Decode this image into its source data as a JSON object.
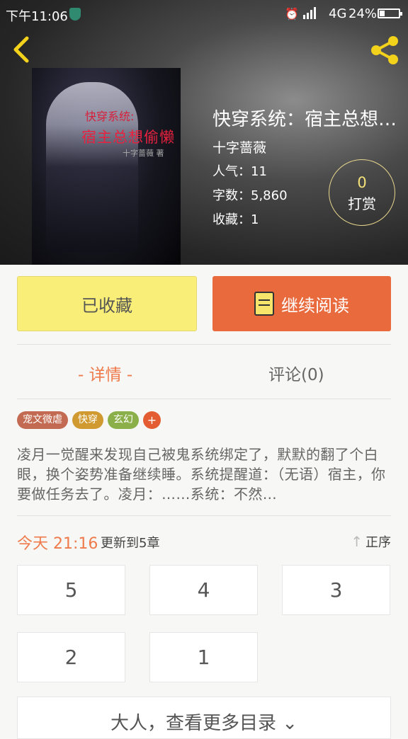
{
  "status_bar": {
    "time": "下午11:06",
    "network": "4G",
    "battery": "24%",
    "battery_level": 0.24
  },
  "book": {
    "title": "快穿系统：宿主总想…",
    "author": "十字蔷薇",
    "popularity": "人气：11",
    "word_count": "字数：5,860",
    "favorites": "收藏：1",
    "reward_count": "0",
    "reward_label": "打赏",
    "cover": {
      "title_line1": "快穿系统:",
      "title_line2": "宿主总想偷懒",
      "author": "十字蔷薇 著"
    }
  },
  "actions": {
    "collected_label": "已收藏",
    "continue_label": "继续阅读"
  },
  "tabs": {
    "detail": "- 详情 -",
    "comments": "评论(0)"
  },
  "tags": [
    "宠文微虐",
    "快穿",
    "玄幻"
  ],
  "tag_add": "+",
  "description": "凌月一觉醒来发现自己被鬼系统绑定了，默默的翻了个白眼，换个姿势准备继续睡。系统提醒道：（无语）宿主，你要做任务去了。凌月：……系统：不然…",
  "update": {
    "time": "今天 21:16",
    "text": "更新到5章",
    "sort_label": "正序"
  },
  "chapters": [
    "5",
    "4",
    "3",
    "2",
    "1"
  ],
  "more_label": "大人，查看更多目录 ⌄",
  "colors": {
    "accent": "#ef7a4c",
    "collected_bg": "#f8ee78",
    "read_bg": "#e96a3c"
  }
}
